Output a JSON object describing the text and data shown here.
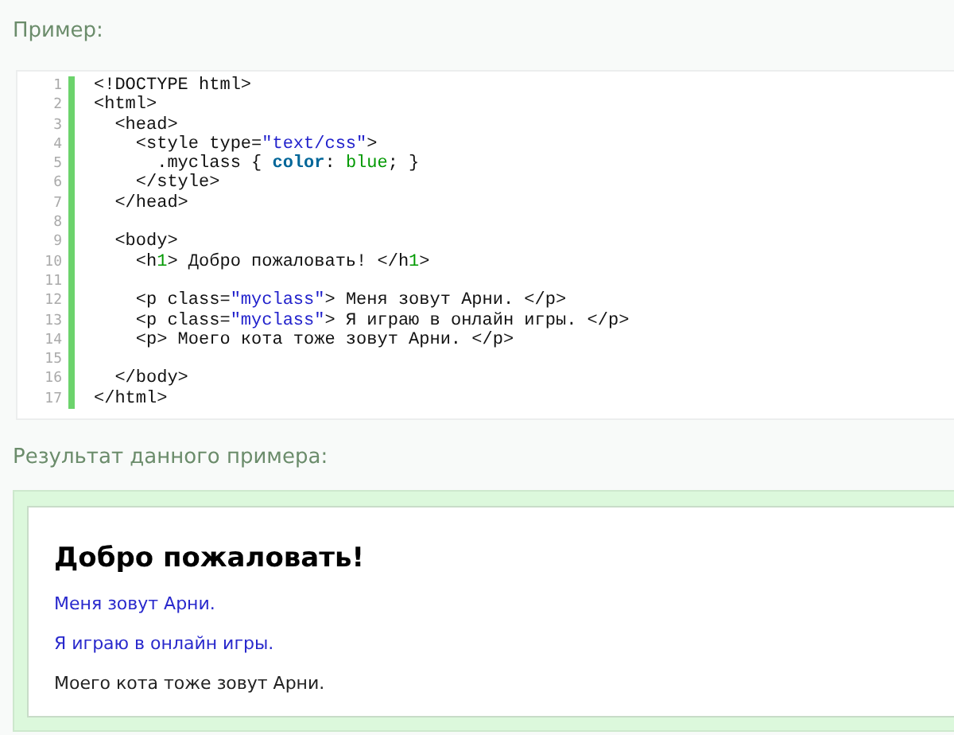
{
  "example_heading": "Пример:",
  "code": [
    {
      "number": "1",
      "tokens": [
        {
          "kind": "plain",
          "text": "<!DOCTYPE html>"
        }
      ]
    },
    {
      "number": "2",
      "tokens": [
        {
          "kind": "plain",
          "text": "<html>"
        }
      ]
    },
    {
      "number": "3",
      "tokens": [
        {
          "kind": "plain",
          "text": "  <head>"
        }
      ]
    },
    {
      "number": "4",
      "tokens": [
        {
          "kind": "plain",
          "text": "    <style type="
        },
        {
          "kind": "string",
          "text": "\"text/css\""
        },
        {
          "kind": "plain",
          "text": ">"
        }
      ]
    },
    {
      "number": "5",
      "tokens": [
        {
          "kind": "plain",
          "text": "      .myclass { "
        },
        {
          "kind": "keyword",
          "text": "color"
        },
        {
          "kind": "plain",
          "text": ": "
        },
        {
          "kind": "value",
          "text": "blue"
        },
        {
          "kind": "plain",
          "text": "; }"
        }
      ]
    },
    {
      "number": "6",
      "tokens": [
        {
          "kind": "plain",
          "text": "    </style>"
        }
      ]
    },
    {
      "number": "7",
      "tokens": [
        {
          "kind": "plain",
          "text": "  </head>"
        }
      ]
    },
    {
      "number": "8"
    },
    {
      "number": "9",
      "tokens": [
        {
          "kind": "plain",
          "text": "  <body>"
        }
      ]
    },
    {
      "number": "10",
      "tokens": [
        {
          "kind": "plain",
          "text": "    <h"
        },
        {
          "kind": "value",
          "text": "1"
        },
        {
          "kind": "plain",
          "text": "> Добро пожаловать! </h"
        },
        {
          "kind": "value",
          "text": "1"
        },
        {
          "kind": "plain",
          "text": ">"
        }
      ]
    },
    {
      "number": "11"
    },
    {
      "number": "12",
      "tokens": [
        {
          "kind": "plain",
          "text": "    <p class="
        },
        {
          "kind": "string",
          "text": "\"myclass\""
        },
        {
          "kind": "plain",
          "text": "> Меня зовут Арни. </p>"
        }
      ]
    },
    {
      "number": "13",
      "tokens": [
        {
          "kind": "plain",
          "text": "    <p class="
        },
        {
          "kind": "string",
          "text": "\"myclass\""
        },
        {
          "kind": "plain",
          "text": "> Я играю в онлайн игры. </p>"
        }
      ]
    },
    {
      "number": "14",
      "tokens": [
        {
          "kind": "plain",
          "text": "    <p> Моего кота тоже зовут Арни. </p>"
        }
      ]
    },
    {
      "number": "15"
    },
    {
      "number": "16",
      "tokens": [
        {
          "kind": "plain",
          "text": "  </body>"
        }
      ]
    },
    {
      "number": "17",
      "tokens": [
        {
          "kind": "plain",
          "text": "</html>"
        }
      ]
    }
  ],
  "result_heading": "Результат данного примера:",
  "result": [
    {
      "kind": "heading",
      "text": "Добро пожаловать!",
      "styled": false
    },
    {
      "kind": "paragraph",
      "text": "Меня зовут Арни.",
      "styled": true
    },
    {
      "kind": "paragraph",
      "text": "Я играю в онлайн игры.",
      "styled": true
    },
    {
      "kind": "paragraph",
      "text": "Моего кота тоже зовут Арни.",
      "styled": false
    }
  ]
}
